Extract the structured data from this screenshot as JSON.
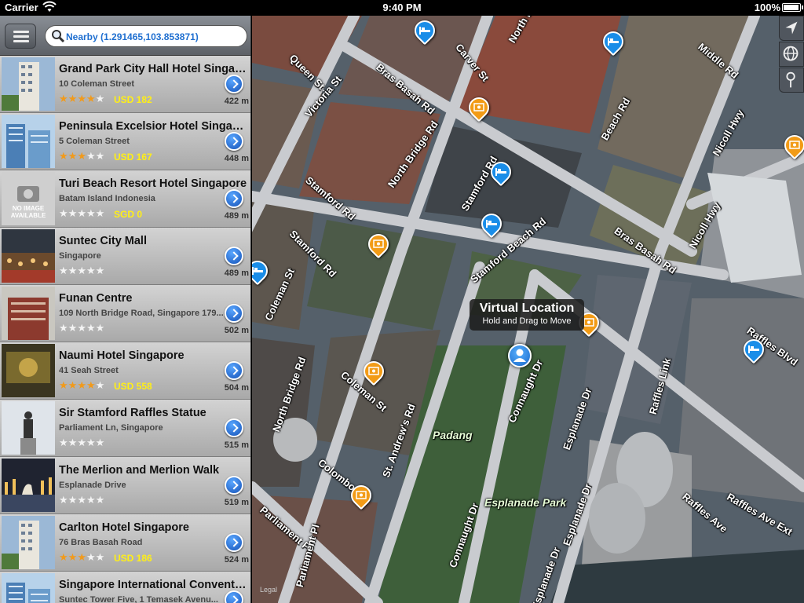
{
  "status": {
    "carrier": "Carrier",
    "time": "9:40 PM",
    "battery": "100%"
  },
  "search": {
    "value": "Nearby (1.291465,103.853871)"
  },
  "results": [
    {
      "name": "Grand Park City Hall Hotel Singapo...",
      "address": "10 Coleman Street",
      "stars": 4,
      "price": "USD 182",
      "distance": "422 m",
      "thumb": "hotel-tower"
    },
    {
      "name": "Peninsula Excelsior Hotel Singap...",
      "address": "5 Coleman Street",
      "stars": 3,
      "price": "USD 167",
      "distance": "448 m",
      "thumb": "hotel-blue"
    },
    {
      "name": "Turi Beach Resort Hotel Singapore",
      "address": "Batam Island Indonesia",
      "stars": 0,
      "price": "SGD 0",
      "distance": "489 m",
      "thumb": "no-image",
      "no_image_text": "NO IMAGE AVAILABLE"
    },
    {
      "name": "Suntec City Mall",
      "address": "Singapore",
      "stars": 0,
      "price": "",
      "distance": "489 m",
      "thumb": "mall"
    },
    {
      "name": "Funan Centre",
      "address": "109 North Bridge Road, Singapore 179...",
      "stars": 0,
      "price": "",
      "distance": "502 m",
      "thumb": "building-red"
    },
    {
      "name": "Naumi Hotel Singapore",
      "address": "41 Seah Street",
      "stars": 4,
      "price": "USD 558",
      "distance": "504 m",
      "thumb": "hotel-lobby"
    },
    {
      "name": "Sir Stamford Raffles Statue",
      "address": "Parliament Ln, Singapore",
      "stars": 0,
      "price": "",
      "distance": "515 m",
      "thumb": "statue"
    },
    {
      "name": "The Merlion and Merlion Walk",
      "address": "Esplanade Drive",
      "stars": 0,
      "price": "",
      "distance": "519 m",
      "thumb": "merlion"
    },
    {
      "name": "Carlton Hotel Singapore",
      "address": "76 Bras Basah Road",
      "stars": 3,
      "price": "USD 186",
      "distance": "524 m",
      "thumb": "hotel-tower"
    },
    {
      "name": "Singapore International Conventio...",
      "address": "Suntec Tower Five, 1 Temasek Avenu...",
      "stars": 0,
      "price": "",
      "distance": "",
      "thumb": "hotel-blue"
    }
  ],
  "map": {
    "streets": [
      "Queen St",
      "Carver St",
      "North Br",
      "Middle Rd",
      "Bras Basah Rd",
      "Victoria St",
      "North Bridge Rd",
      "Beach Rd",
      "Nicoll Hwy",
      "Stamford Rd",
      "Stamford Rd",
      "Stamford Rd",
      "Stamford Beach Rd",
      "Nicoll Hwy",
      "Bras Basah Rd",
      "Coleman St",
      "Coleman St",
      "North Bridge Rd",
      "St. Andrew's Rd",
      "Connaught Dr",
      "Esplanade Dr",
      "Raffles Link",
      "Raffles Blvd",
      "Colombo Ct",
      "Parliament Pl",
      "Parliament Pl",
      "Connaught Dr",
      "Esplanade Dr",
      "Esplanade Dr",
      "Raffles Ave",
      "Raffles Ave Ext"
    ],
    "area_labels": [
      "Padang",
      "Esplanade Park"
    ],
    "legal": "Legal",
    "tooltip_title": "Virtual Location",
    "tooltip_subtitle": "Hold and Drag to Move"
  },
  "colors": {
    "hotel_pin": "#1a8de8",
    "poi_pin": "#f29b16",
    "star_on": "#f19a1b",
    "price": "#ffef16",
    "search_text": "#1f6fd0"
  }
}
